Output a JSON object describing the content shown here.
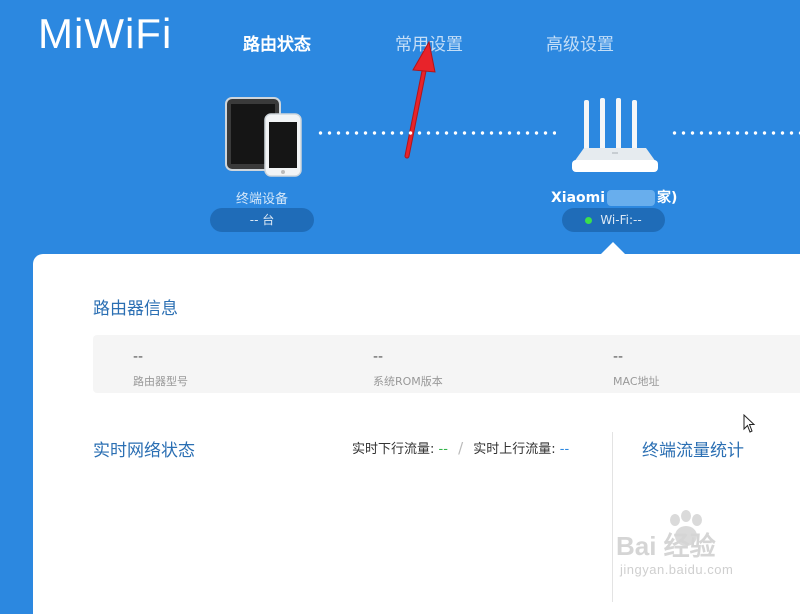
{
  "logo": {
    "text": "MiWiFi"
  },
  "nav": {
    "tabs": [
      {
        "label": "路由状态",
        "active": true
      },
      {
        "label": "常用设置",
        "active": false
      },
      {
        "label": "高级设置",
        "active": false
      }
    ]
  },
  "topology": {
    "devices": {
      "label": "终端设备",
      "count_text": "-- 台"
    },
    "router": {
      "name_prefix": "Xiaomi",
      "name_suffix": "家)",
      "wifi_text": "Wi-Fi:--"
    }
  },
  "router_info": {
    "title": "路由器信息",
    "items": [
      {
        "value": "--",
        "label": "路由器型号"
      },
      {
        "value": "--",
        "label": "系统ROM版本"
      },
      {
        "value": "--",
        "label": "MAC地址"
      }
    ]
  },
  "network_status": {
    "title": "实时网络状态",
    "down_label": "实时下行流量:",
    "down_value": "--",
    "separator": "/",
    "up_label": "实时上行流量:",
    "up_value": "--"
  },
  "terminal_traffic": {
    "title": "终端流量统计"
  },
  "watermark": {
    "main": "Bai 经验",
    "sub": "jingyan.baidu.com"
  },
  "colors": {
    "header_bg": "#2c88e0",
    "pill_bg": "#1f6cb8",
    "title_blue": "#2b6fb3",
    "wifi_dot": "#3be04c",
    "arrow": "#e8232a"
  }
}
